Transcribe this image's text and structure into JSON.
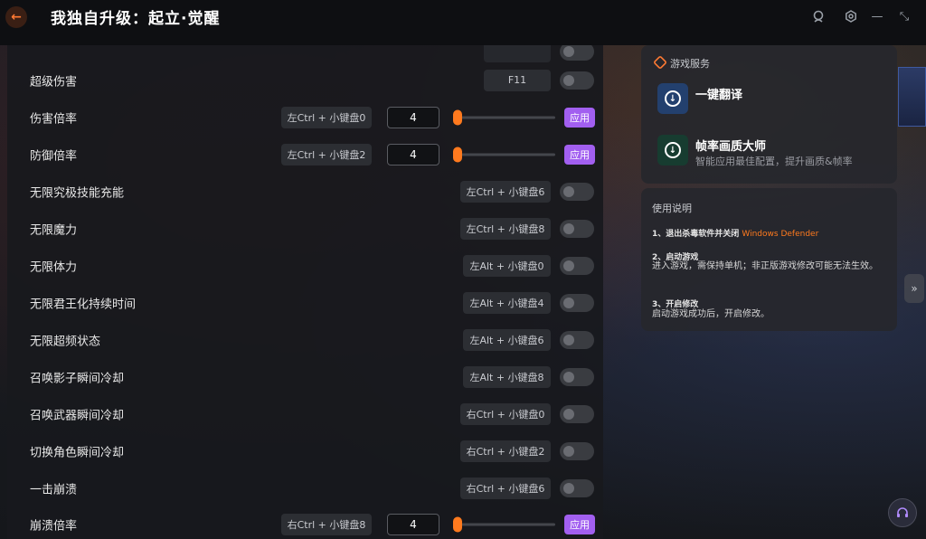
{
  "app": {
    "title": "我独自升级：起立·觉醒"
  },
  "rows": [
    {
      "label": "超级伤害",
      "hotkey": "F11",
      "type": "toggle"
    },
    {
      "label": "伤害倍率",
      "hotkey": "左Ctrl + 小键盘0",
      "type": "slider",
      "value": "4",
      "apply": "应用"
    },
    {
      "label": "防御倍率",
      "hotkey": "左Ctrl + 小键盘2",
      "type": "slider",
      "value": "4",
      "apply": "应用"
    },
    {
      "label": "无限究极技能充能",
      "hotkey": "左Ctrl + 小键盘6",
      "type": "toggle"
    },
    {
      "label": "无限魔力",
      "hotkey": "左Ctrl + 小键盘8",
      "type": "toggle"
    },
    {
      "label": "无限体力",
      "hotkey": "左Alt + 小键盘0",
      "type": "toggle"
    },
    {
      "label": "无限君王化持续时间",
      "hotkey": "左Alt + 小键盘4",
      "type": "toggle"
    },
    {
      "label": "无限超频状态",
      "hotkey": "左Alt + 小键盘6",
      "type": "toggle"
    },
    {
      "label": "召唤影子瞬间冷却",
      "hotkey": "左Alt + 小键盘8",
      "type": "toggle"
    },
    {
      "label": "召唤武器瞬间冷却",
      "hotkey": "右Ctrl + 小键盘0",
      "type": "toggle"
    },
    {
      "label": "切换角色瞬间冷却",
      "hotkey": "右Ctrl + 小键盘2",
      "type": "toggle"
    },
    {
      "label": "一击崩溃",
      "hotkey": "右Ctrl + 小键盘6",
      "type": "toggle"
    },
    {
      "label": "崩溃倍率",
      "hotkey": "右Ctrl + 小键盘8",
      "type": "slider",
      "value": "4",
      "apply": "应用"
    }
  ],
  "service": {
    "heading": "游戏服务",
    "items": [
      {
        "title": "一键翻译",
        "desc": ""
      },
      {
        "title": "帧率画质大师",
        "desc": "智能应用最佳配置，提升画质&帧率"
      }
    ]
  },
  "instructions": {
    "heading": "使用说明",
    "step1": "1、退出杀毒软件并关闭",
    "step1_highlight": "Windows Defender",
    "step2_title": "2、启动游戏",
    "step2_text": "进入游戏，需保持单机；非正版游戏修改可能无法生效。",
    "step3_title": "3、开启修改",
    "step3_text": "启动游戏成功后，开启修改。"
  },
  "colors": {
    "accent": "#ff7a1e",
    "apply": "#a25ff0"
  },
  "icons": {
    "back": "back-arrow-icon",
    "account": "account-icon",
    "settings": "settings-icon",
    "minimize": "minimize-icon",
    "fullscreen": "fullscreen-icon",
    "collapse": "chevron-right-icon",
    "support": "headset-icon"
  }
}
